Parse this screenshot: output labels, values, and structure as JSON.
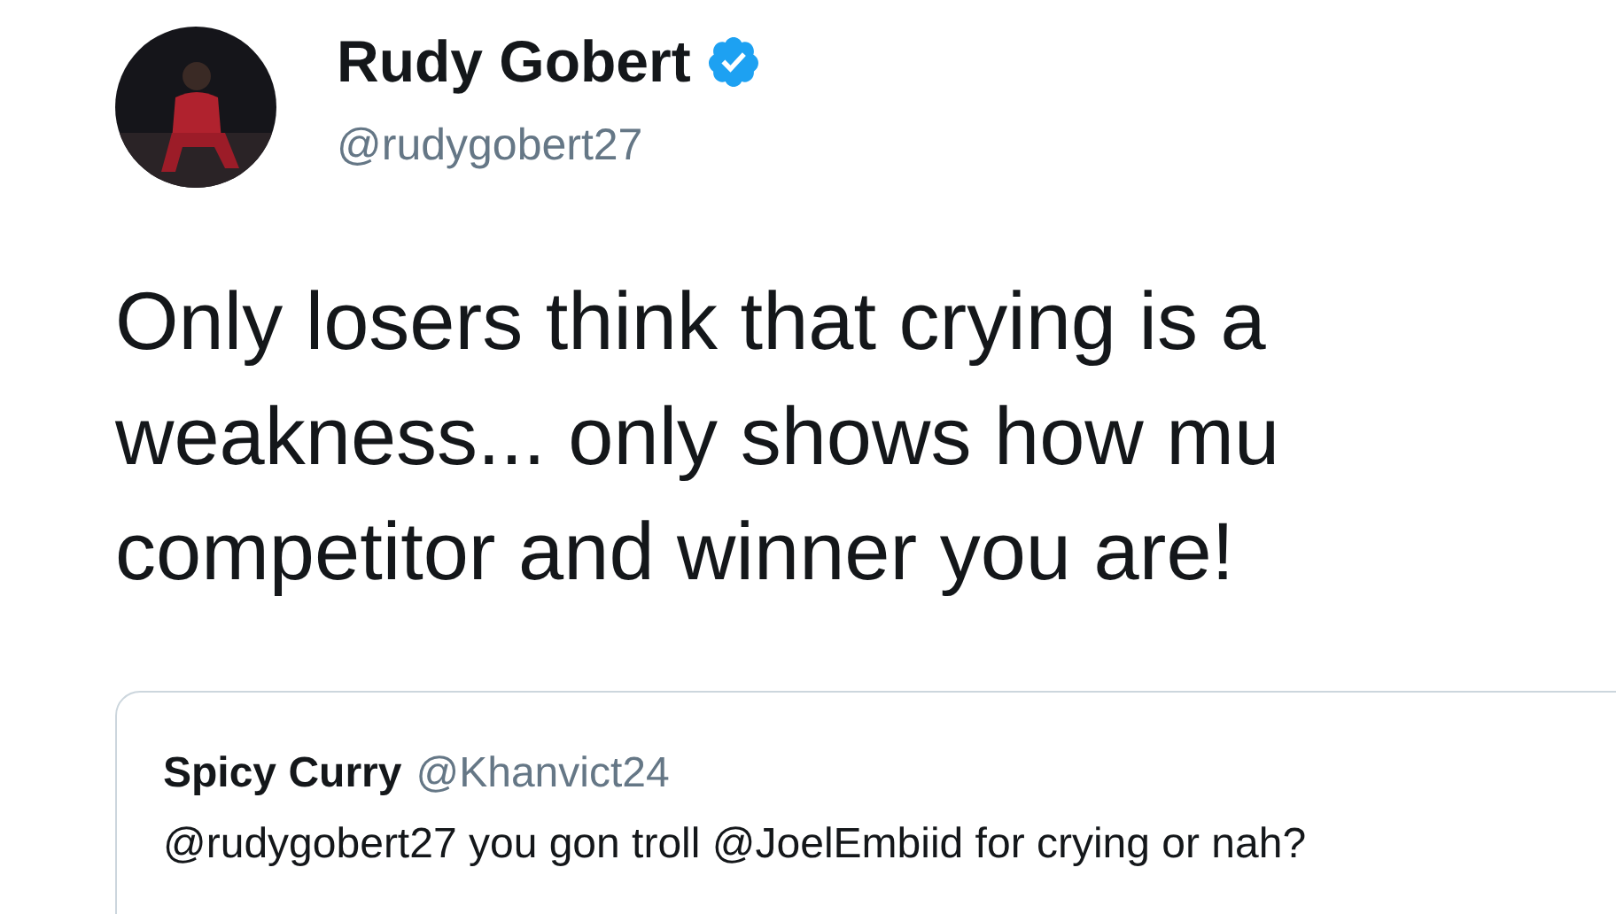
{
  "author": {
    "name": "Rudy Gobert",
    "verified": true,
    "handle": "@rudygobert27"
  },
  "tweet": {
    "lines": [
      "Only losers think that crying is a",
      "weakness... only shows how mu",
      "competitor and winner you are!"
    ]
  },
  "quoted": {
    "name": "Spicy Curry",
    "handle": "@Khanvict24",
    "text": "@rudygobert27 you gon troll @JoelEmbiid for crying or nah?"
  }
}
